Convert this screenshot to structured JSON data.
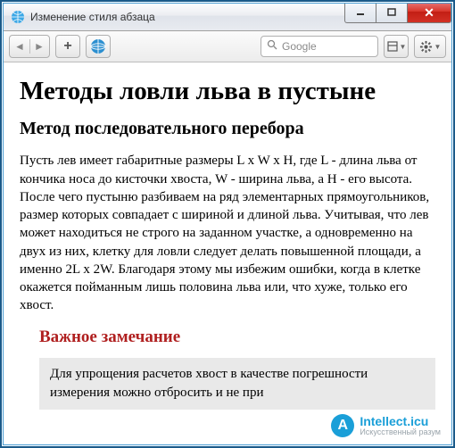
{
  "window": {
    "title": "Изменение стиля абзаца"
  },
  "toolbar": {
    "back": "◄",
    "fwd": "►",
    "plus": "+",
    "search_placeholder": "Google"
  },
  "page": {
    "h1": "Методы ловли льва в пустыне",
    "h2": "Метод последовательного перебора",
    "body": "Пусть лев имеет габаритные размеры L x W x H, где L - длина льва от кончика носа до кисточки хвоста, W - ширина льва, а H - его высота. После чего пустыню разбиваем на ряд элементарных прямоугольников, размер которых совпадает с шириной и длиной льва. Учитывая, что лев может находиться не строго на заданном участке, а одновременно на двух из них, клетку для ловли следует делать повышенной площади, а именно 2L x 2W. Благодаря этому мы избежим ошибки, когда в клетке окажется пойманным лишь половина льва или, что хуже, только его хвост.",
    "note_title": "Важное замечание",
    "note_body": "Для упрощения расчетов хвост в качестве погрешности измерения можно отбросить и не при"
  },
  "watermark": {
    "brand": "Intellect.icu",
    "tag": "Искусственный разум",
    "logo": "A"
  }
}
